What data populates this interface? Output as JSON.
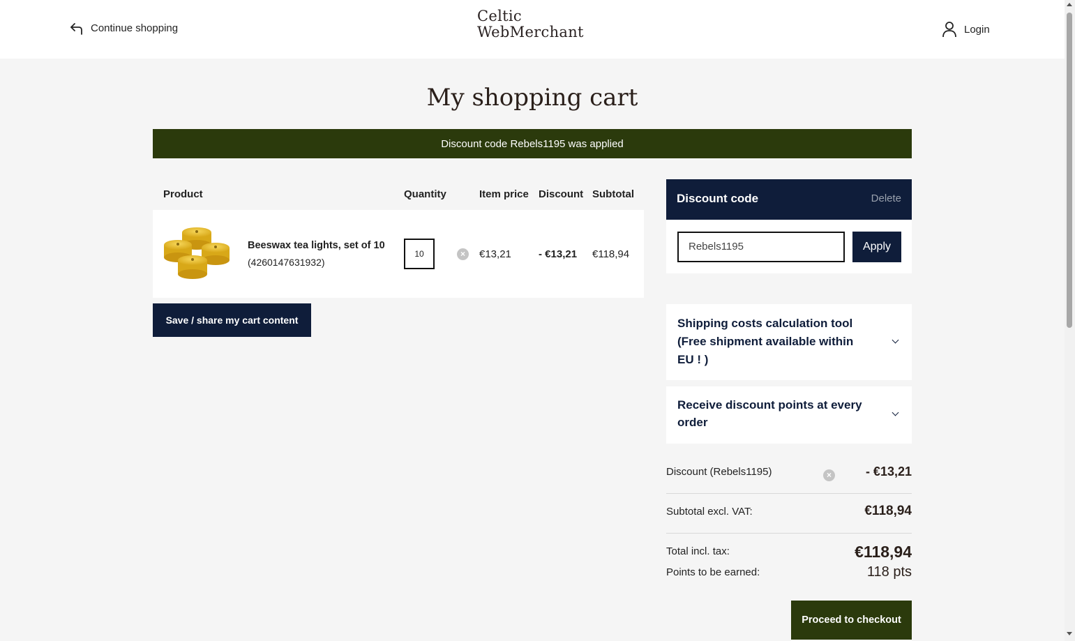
{
  "header": {
    "continue_label": "Continue shopping",
    "logo_line1": "Celtic",
    "logo_line2": "WebMerchant",
    "login_label": "Login"
  },
  "page_title": "My shopping cart",
  "notice": "Discount code Rebels1195 was applied",
  "cart": {
    "columns": {
      "product": "Product",
      "quantity": "Quantity",
      "item_price": "Item price",
      "discount": "Discount",
      "subtotal": "Subtotal"
    },
    "items": [
      {
        "name": "Beeswax tea lights, set of 10",
        "sku": "(4260147631932)",
        "quantity": "10",
        "item_price": "€13,21",
        "discount": "- €13,21",
        "subtotal": "€118,94"
      }
    ],
    "save_label": "Save / share my cart content"
  },
  "discount_panel": {
    "title": "Discount code",
    "delete_label": "Delete",
    "input_value": "Rebels1195",
    "apply_label": "Apply"
  },
  "accordions": {
    "shipping": "Shipping costs calculation tool (Free shipment available within EU ! )",
    "points": "Receive discount points at every order"
  },
  "summary": {
    "discount_label": "Discount (Rebels1195)",
    "discount_value": "- €13,21",
    "subtotal_label": "Subtotal excl. VAT:",
    "subtotal_value": "€118,94",
    "total_label": "Total incl. tax:",
    "total_value": "€118,94",
    "points_label": "Points to be earned:",
    "points_value": "118 pts"
  },
  "checkout_label": "Proceed to checkout",
  "colors": {
    "navy": "#0f1d3a",
    "olive": "#2b3a0c",
    "background": "#f5f5f5"
  }
}
